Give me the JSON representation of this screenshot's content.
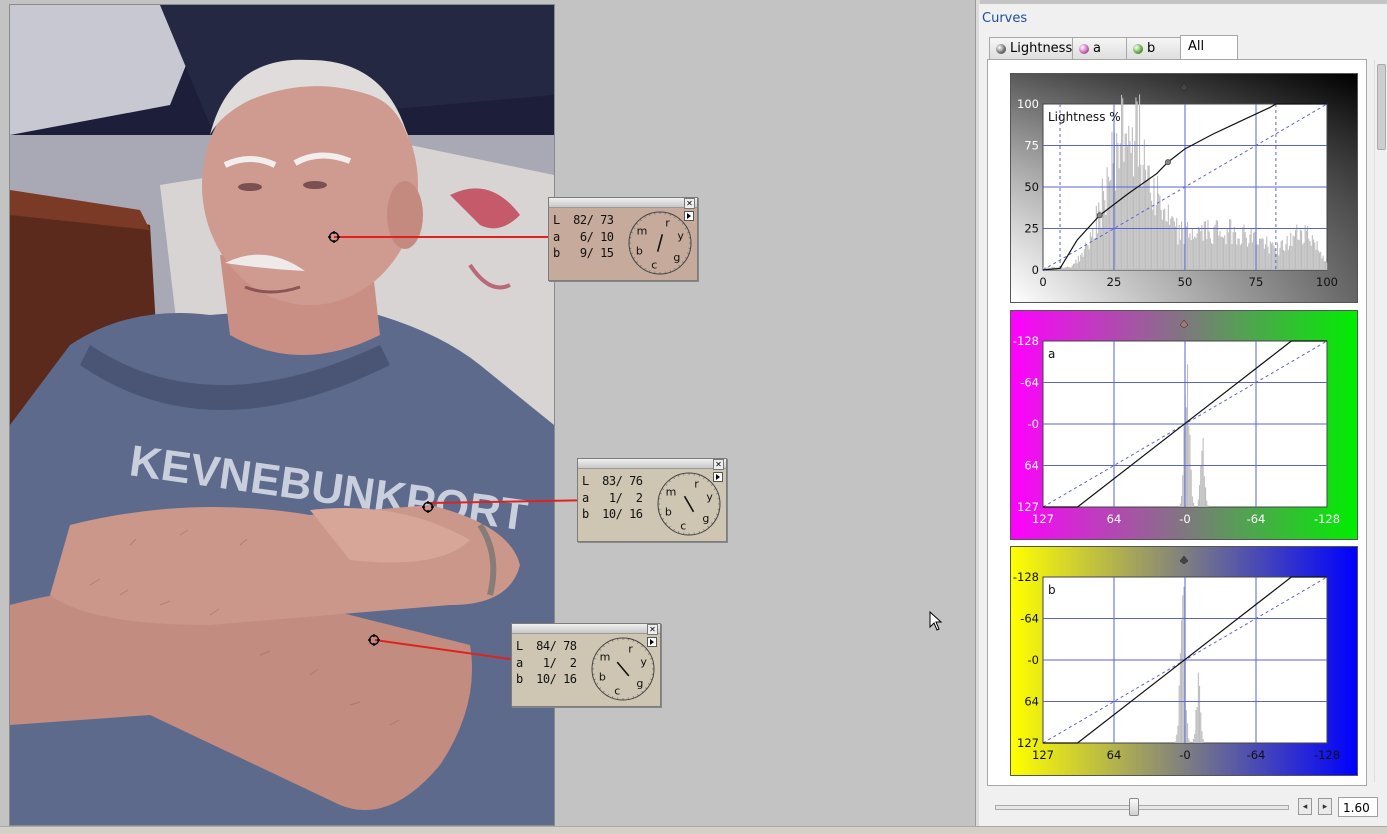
{
  "panel": {
    "title": "Curves"
  },
  "tabs": [
    {
      "label": "Lightness",
      "dot": "#6a6a6a"
    },
    {
      "label": "a",
      "dot": "#c65bb7"
    },
    {
      "label": "b",
      "dot": "#58a83c"
    },
    {
      "label": "All"
    }
  ],
  "samplers": [
    {
      "L": "L  82/ 73",
      "a": "a   6/ 10",
      "b": "b   9/ 15",
      "bg": "#c6aa9b"
    },
    {
      "L": "L  83/ 76",
      "a": "a   1/  2",
      "b": "b  10/ 16",
      "bg": "#cec6b2"
    },
    {
      "L": "L  84/ 78",
      "a": "a   1/  2",
      "b": "b  10/ 16",
      "bg": "#cec6b2"
    }
  ],
  "wheel_labels": [
    "r",
    "y",
    "g",
    "c",
    "b",
    "m"
  ],
  "curves": {
    "lightness": {
      "label": "Lightness %",
      "y_ticks": [
        "100",
        "75",
        "50",
        "25",
        "0"
      ],
      "x_ticks": [
        "0",
        "25",
        "50",
        "75",
        "100"
      ],
      "range": [
        0,
        100
      ],
      "curve_points": [
        [
          0,
          0
        ],
        [
          6,
          1
        ],
        [
          12,
          18
        ],
        [
          20,
          33
        ],
        [
          30,
          46
        ],
        [
          40,
          58
        ],
        [
          44,
          65
        ],
        [
          50,
          73
        ],
        [
          60,
          82
        ],
        [
          70,
          90
        ],
        [
          80,
          98
        ],
        [
          82,
          100
        ],
        [
          100,
          100
        ]
      ],
      "black_point": 0,
      "white_point": 82,
      "gradient": [
        "#ffffff",
        "#000000"
      ]
    },
    "a": {
      "label": "a",
      "y_ticks": [
        "-128",
        "-64",
        "-0",
        "64",
        "127"
      ],
      "x_ticks": [
        "127",
        "64",
        "-0",
        "-64",
        "-128"
      ],
      "range": [
        127,
        -128
      ],
      "curve_points": [
        [
          127,
          127
        ],
        [
          96,
          127
        ],
        [
          -96,
          -128
        ],
        [
          -128,
          -128
        ]
      ],
      "colors": [
        "#ff00ff",
        "#00ee00"
      ]
    },
    "b": {
      "label": "b",
      "y_ticks": [
        "-128",
        "-64",
        "-0",
        "64",
        "127"
      ],
      "x_ticks": [
        "127",
        "64",
        "-0",
        "-64",
        "-128"
      ],
      "range": [
        127,
        -128
      ],
      "curve_points": [
        [
          127,
          127
        ],
        [
          96,
          127
        ],
        [
          -96,
          -128
        ],
        [
          -128,
          -128
        ]
      ],
      "colors": [
        "#ffff00",
        "#0000ff"
      ]
    }
  },
  "zoom": {
    "value": "1.60",
    "level": 0.47
  },
  "photo": {
    "shirt_text": "KEVNEBUNKPORT"
  }
}
